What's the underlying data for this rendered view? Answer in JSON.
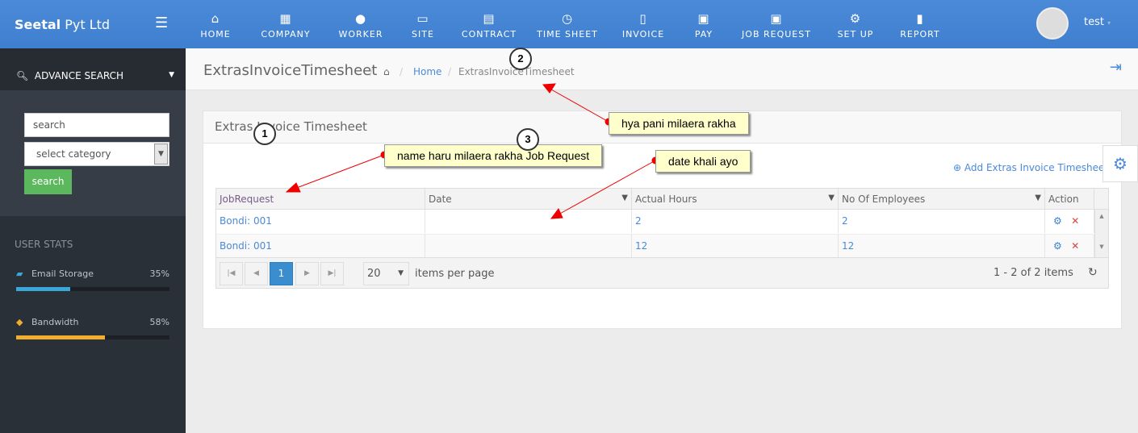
{
  "header": {
    "brand_bold": "Seetal",
    "brand_rest": " Pyt Ltd",
    "menu_icon": "hamburger-icon",
    "nav": [
      {
        "label": "HOME",
        "icon": "home-icon",
        "g": "⌂"
      },
      {
        "label": "COMPANY",
        "icon": "building-icon",
        "g": "▦"
      },
      {
        "label": "WORKER",
        "icon": "user-icon",
        "g": "●"
      },
      {
        "label": "SITE",
        "icon": "monitor-icon",
        "g": "▭"
      },
      {
        "label": "CONTRACT",
        "icon": "document-icon",
        "g": "▤"
      },
      {
        "label": "TIME SHEET",
        "icon": "clock-icon",
        "g": "◷"
      },
      {
        "label": "INVOICE",
        "icon": "file-icon",
        "g": "▯"
      },
      {
        "label": "PAY",
        "icon": "money-icon",
        "g": "▣"
      },
      {
        "label": "JOB REQUEST",
        "icon": "money-icon",
        "g": "▣"
      },
      {
        "label": "SET UP",
        "icon": "gear-icon",
        "g": "⚙"
      },
      {
        "label": "REPORT",
        "icon": "file-icon",
        "g": "▮"
      }
    ],
    "user": "test"
  },
  "sidebar": {
    "advance_search": "ADVANCE SEARCH",
    "search_placeholder": "search",
    "category": "select category",
    "search_button": "search",
    "user_stats": "USER STATS",
    "stats": [
      {
        "label": "Email Storage",
        "value": "35%",
        "percent": 35,
        "color": "#3aa7d8"
      },
      {
        "label": "Bandwidth",
        "value": "58%",
        "percent": 58,
        "color": "#f0ad2e"
      }
    ]
  },
  "page": {
    "title": "ExtrasInvoiceTimesheet",
    "breadcrumb": [
      "Home",
      "ExtrasInvoiceTimesheet"
    ]
  },
  "panel": {
    "title": "Extras Invoice Timesheet",
    "add_link": "Add Extras Invoice Timesheet"
  },
  "grid": {
    "columns": [
      "JobRequest",
      "Date",
      "Actual Hours",
      "No Of Employees",
      "Action"
    ],
    "rows": [
      {
        "job": "Bondi: 001",
        "date": "",
        "hours": "2",
        "employees": "2"
      },
      {
        "job": "Bondi: 001",
        "date": "",
        "hours": "12",
        "employees": "12"
      }
    ],
    "page": "1",
    "page_size": "20",
    "items_per_page": "items per page",
    "summary": "1 - 2 of 2 items"
  },
  "annotations": [
    {
      "num": "1",
      "text": "name haru milaera rakha  Job Request"
    },
    {
      "num": "2",
      "text": "hya pani milaera rakha"
    },
    {
      "num": "3",
      "text": "date khali ayo"
    }
  ]
}
